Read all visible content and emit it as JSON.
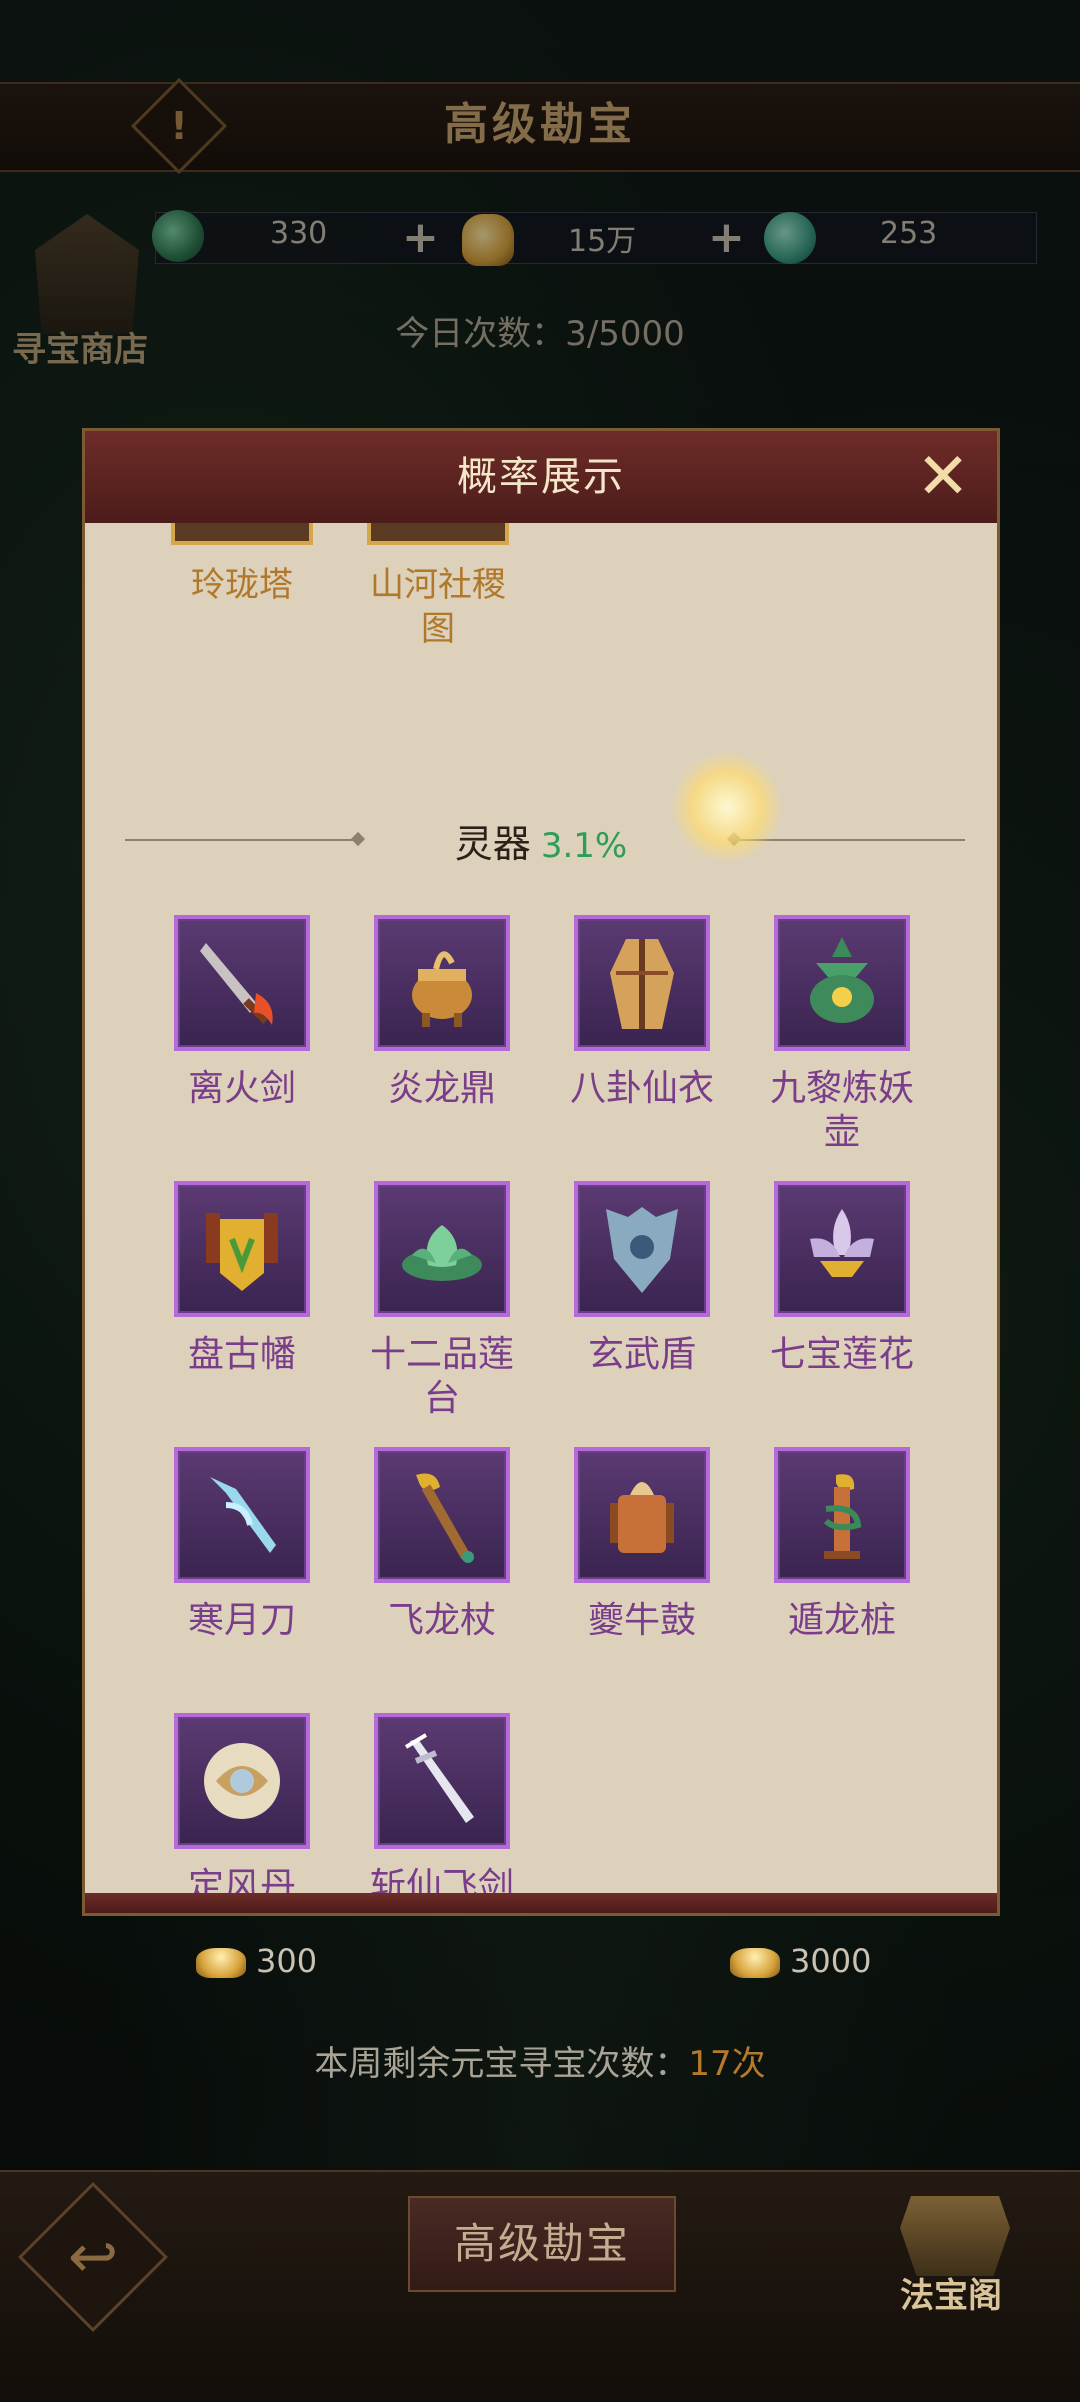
{
  "header": {
    "title": "高级勘宝",
    "info_icon": "!"
  },
  "resources": [
    {
      "name": "jade-token",
      "value": "330"
    },
    {
      "name": "gold-ingot",
      "value": "15万"
    },
    {
      "name": "jade-coin",
      "value": "253"
    }
  ],
  "shop": {
    "label": "寻宝商店"
  },
  "today": {
    "text": "今日次数：3/5000"
  },
  "modal": {
    "title": "概率展示",
    "close": "✕",
    "top_items": [
      "玲珑塔",
      "山河社稷\n图"
    ],
    "section": {
      "label": "灵器",
      "pct": "3.1%"
    },
    "items": [
      "离火剑",
      "炎龙鼎",
      "八卦仙衣",
      "九黎炼妖\n壶",
      "盘古幡",
      "十二品莲\n台",
      "玄武盾",
      "七宝莲花",
      "寒月刀",
      "飞龙杖",
      "夔牛鼓",
      "遁龙桩",
      "定风丹",
      "斩仙飞剑"
    ]
  },
  "costs": [
    "300",
    "3000"
  ],
  "weekly": {
    "prefix": "本周剩余元宝寻宝次数：",
    "count": "17次"
  },
  "bottom": {
    "main_button": "高级勘宝",
    "back": "↩",
    "treasure_label": "法宝阁"
  }
}
